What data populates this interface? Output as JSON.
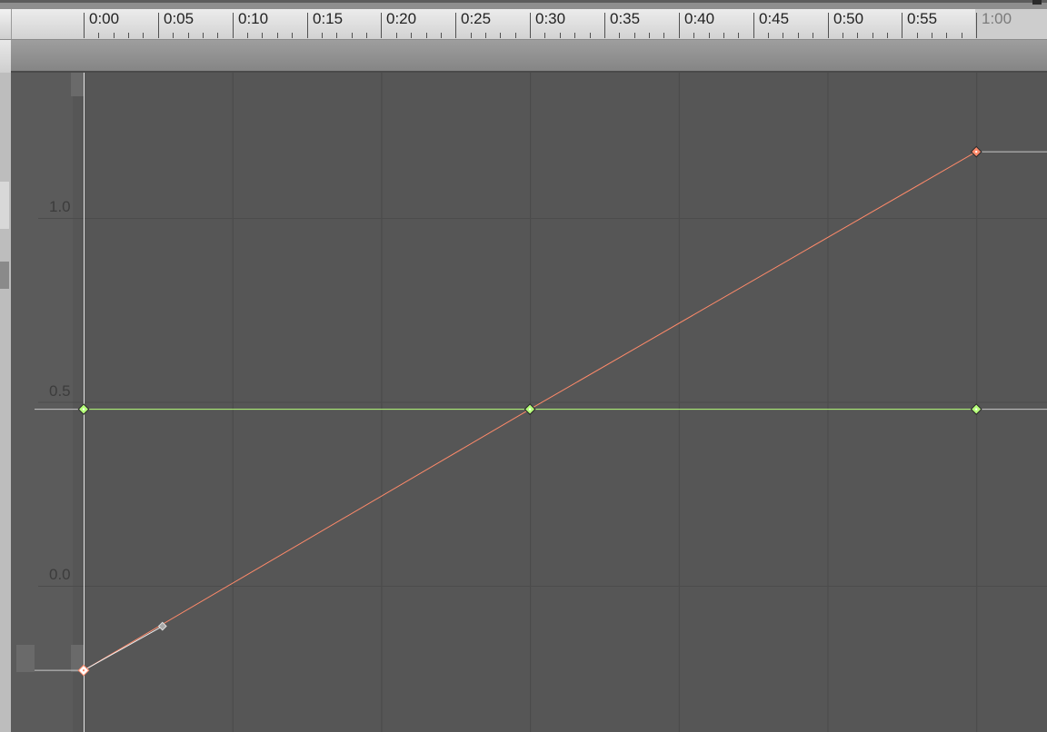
{
  "timeline": {
    "ticks": [
      "0:00",
      "0:05",
      "0:10",
      "0:15",
      "0:20",
      "0:25",
      "0:30",
      "0:35",
      "0:40",
      "0:45",
      "0:50",
      "0:55",
      "1:00"
    ]
  },
  "value_axis": {
    "labels": [
      "1.0",
      "0.5",
      "0.0"
    ]
  },
  "curves": [
    {
      "color": "#ff8a6a",
      "keys": [
        {
          "t": 0,
          "v": -0.23
        },
        {
          "t": 30,
          "v": 0.48
        },
        {
          "t": 60,
          "v": 1.18
        }
      ],
      "selected_key_index": 0,
      "tangent_handle": {
        "t": 5.3,
        "v": -0.11
      }
    },
    {
      "color": "#b6ff7a",
      "keys": [
        {
          "t": 0,
          "v": 0.48
        },
        {
          "t": 30,
          "v": 0.48
        },
        {
          "t": 60,
          "v": 0.48
        }
      ]
    }
  ]
}
